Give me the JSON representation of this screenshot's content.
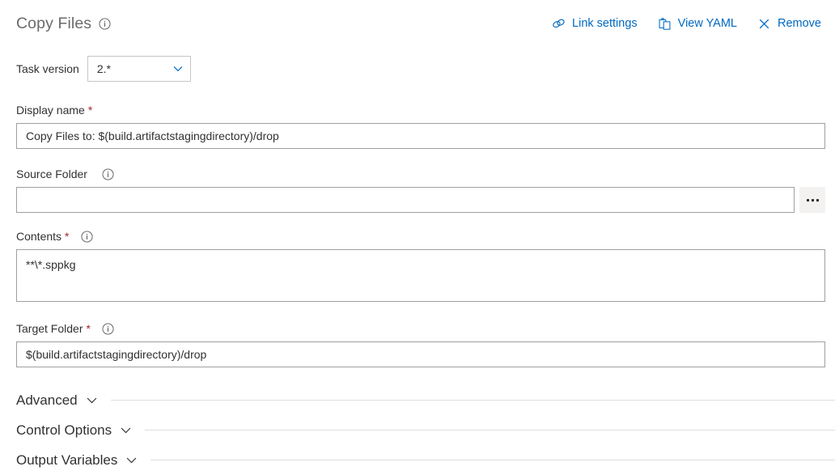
{
  "header": {
    "title": "Copy Files",
    "info_icon": "info-circle-icon",
    "actions": [
      {
        "label": "Link settings",
        "icon": "link-chain-icon"
      },
      {
        "label": "View YAML",
        "icon": "clipboard-icon"
      },
      {
        "label": "Remove",
        "icon": "close-x-icon"
      }
    ]
  },
  "task_version": {
    "label": "Task version",
    "value": "2.*",
    "chevron_icon": "chevron-down-icon"
  },
  "fields": {
    "display_name": {
      "label": "Display name",
      "required": "*",
      "value": "Copy Files to: $(build.artifactstagingdirectory)/drop",
      "placeholder": ""
    },
    "source_folder": {
      "label": "Source Folder",
      "required": "",
      "info_icon": "info-circle-icon",
      "value": "",
      "placeholder": "",
      "browse_icon": "ellipsis-icon"
    },
    "contents": {
      "label": "Contents",
      "required": "*",
      "info_icon": "info-circle-icon",
      "value": "**\\*.sppkg",
      "placeholder": ""
    },
    "target_folder": {
      "label": "Target Folder",
      "required": "*",
      "info_icon": "info-circle-icon",
      "value": "$(build.artifactstagingdirectory)/drop",
      "placeholder": ""
    }
  },
  "sections": [
    {
      "label": "Advanced",
      "chevron_icon": "chevron-down-icon"
    },
    {
      "label": "Control Options",
      "chevron_icon": "chevron-down-icon"
    },
    {
      "label": "Output Variables",
      "chevron_icon": "chevron-down-icon"
    }
  ],
  "colors": {
    "accent": "#0069c0",
    "required_asterisk": "#a4262c",
    "title_text": "#6b6b6b",
    "body_text": "#323130",
    "border": "#a19f9d",
    "divider": "#e1dfdd",
    "button_bg": "#f3f2f1"
  }
}
